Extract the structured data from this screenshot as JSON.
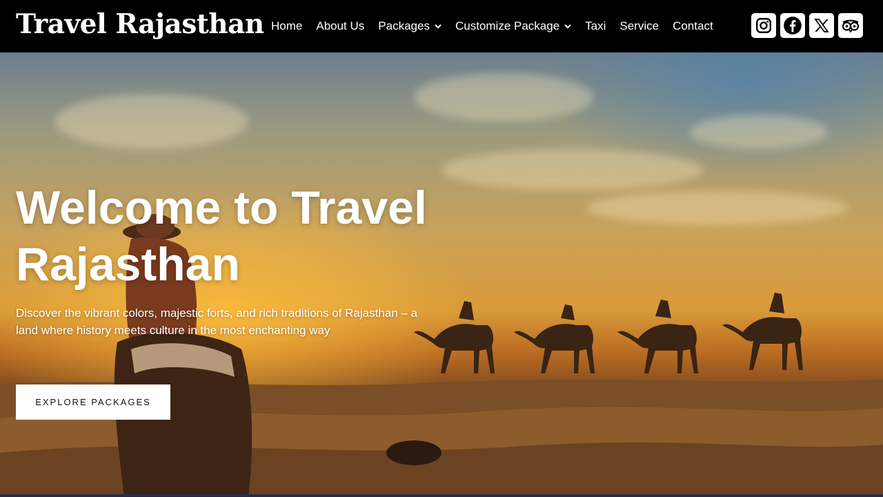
{
  "header": {
    "logo": "Travel Rajasthan",
    "nav": [
      {
        "label": "Home",
        "dropdown": false
      },
      {
        "label": "About Us",
        "dropdown": false
      },
      {
        "label": "Packages",
        "dropdown": true
      },
      {
        "label": "Customize Package",
        "dropdown": true
      },
      {
        "label": "Taxi",
        "dropdown": false
      },
      {
        "label": "Service",
        "dropdown": false
      },
      {
        "label": "Contact",
        "dropdown": false
      }
    ],
    "socials": [
      "instagram-icon",
      "facebook-icon",
      "x-icon",
      "tripadvisor-icon"
    ]
  },
  "hero": {
    "title": "Welcome to Travel Rajasthan",
    "description": "Discover the vibrant colors, majestic forts, and rich traditions of Rajasthan – a land where history meets culture in the most enchanting way",
    "cta_label": "EXPLORE PACKAGES"
  },
  "colors": {
    "header_bg": "#000000",
    "text": "#ffffff",
    "button_bg": "#ffffff",
    "button_text": "#111111"
  }
}
